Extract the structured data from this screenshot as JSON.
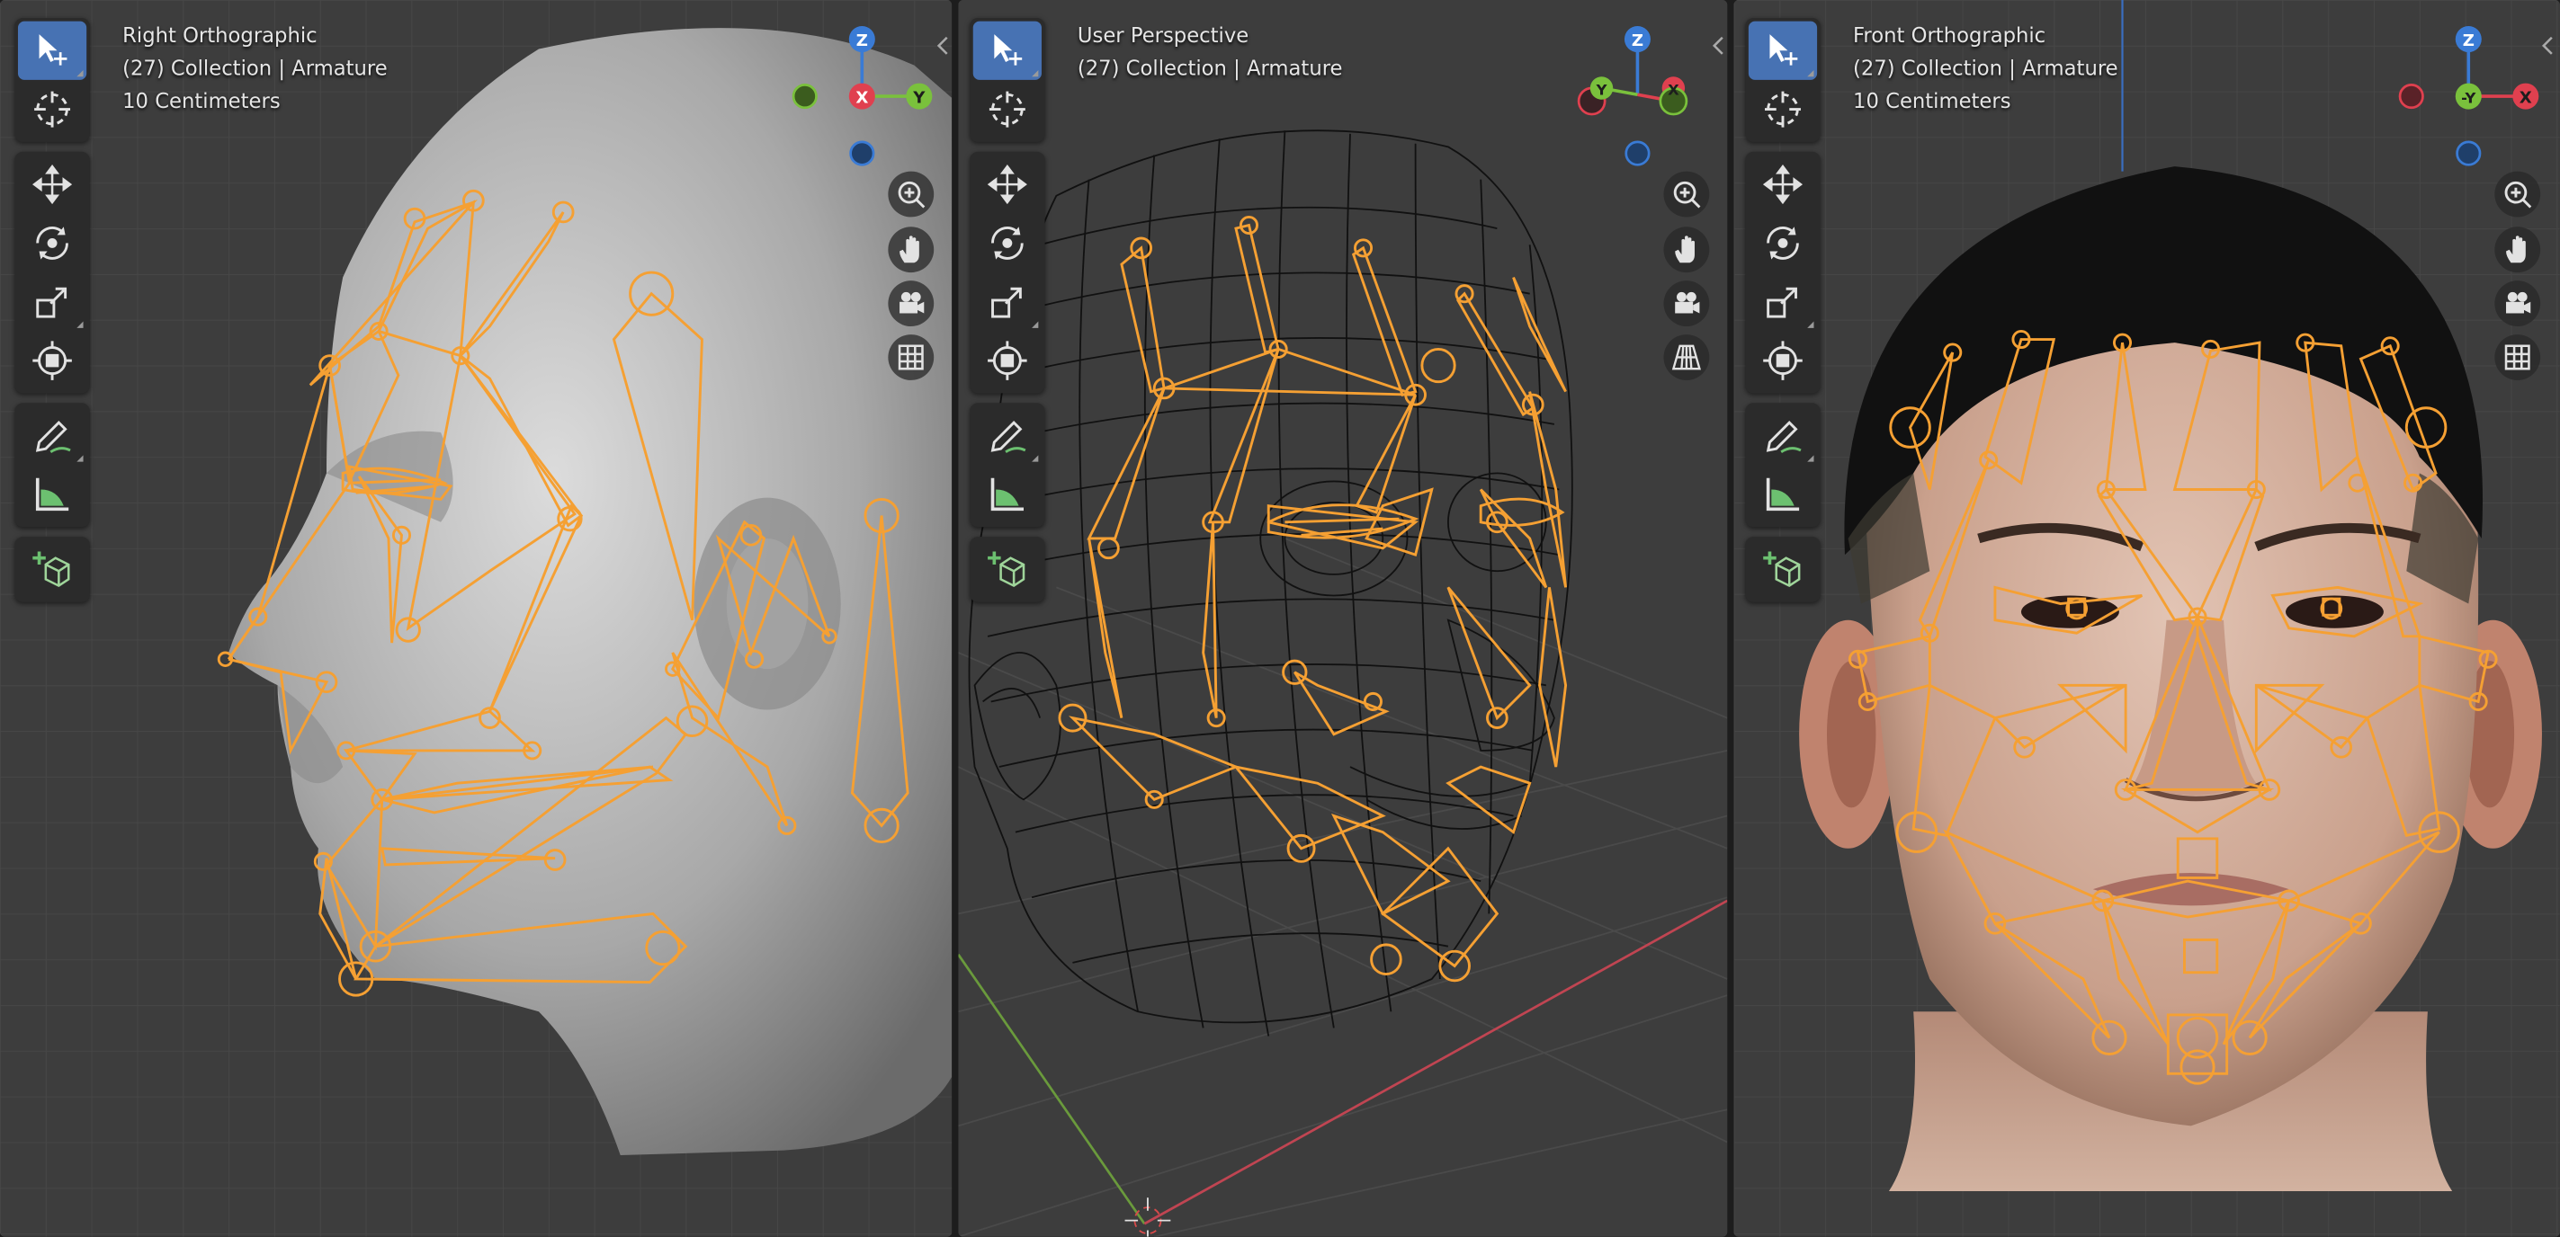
{
  "viewports": [
    {
      "id": "left",
      "view_name": "Right Orthographic",
      "collection": "(27) Collection | Armature",
      "scale": "10 Centimeters",
      "gizmo": {
        "top": "Z",
        "center": "X",
        "right": "Y"
      }
    },
    {
      "id": "middle",
      "view_name": "User Perspective",
      "collection": "(27) Collection | Armature",
      "scale": "",
      "gizmo": {
        "top": "Z",
        "left": "Y",
        "right": "X"
      }
    },
    {
      "id": "right",
      "view_name": "Front Orthographic",
      "collection": "(27) Collection | Armature",
      "scale": "10 Centimeters",
      "gizmo": {
        "top": "Z",
        "center": "-Y",
        "right": "X"
      }
    }
  ],
  "tools": [
    "select-box-icon",
    "cursor-icon",
    "move-icon",
    "rotate-icon",
    "scale-icon",
    "transform-icon",
    "annotate-icon",
    "measure-icon",
    "add-cube-icon"
  ],
  "nav_tools": [
    "zoom-icon",
    "pan-hand-icon",
    "camera-icon",
    "grid-icon"
  ],
  "colors": {
    "viewport_bg": "#3d3d3d",
    "bone_orange": "#f5a033",
    "active_tool": "#4772b3",
    "axis_x": "#e0404f",
    "axis_y": "#7ac13c",
    "axis_z": "#3a7bd5"
  }
}
